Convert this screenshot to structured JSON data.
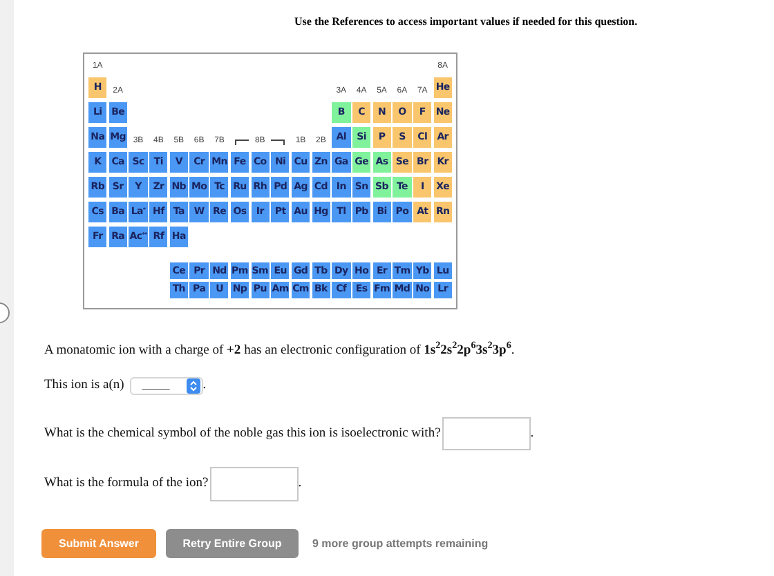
{
  "header": "Use the References to access important values if needed for this question.",
  "periodic_table": {
    "rows": [
      [
        {
          "label": "1A"
        },
        null,
        null,
        null,
        null,
        null,
        null,
        null,
        null,
        null,
        null,
        null,
        null,
        null,
        null,
        null,
        null,
        {
          "label": "8A"
        }
      ],
      [
        {
          "symbol": "H",
          "color": "#f9c66d"
        },
        {
          "label": "2A"
        },
        null,
        null,
        null,
        null,
        null,
        null,
        null,
        null,
        null,
        null,
        {
          "label": "3A"
        },
        {
          "label": "4A"
        },
        {
          "label": "5A"
        },
        {
          "label": "6A"
        },
        {
          "label": "7A"
        },
        {
          "symbol": "He",
          "color": "#f9c66d"
        }
      ],
      [
        {
          "symbol": "Li",
          "color": "#4b98f4"
        },
        {
          "symbol": "Be",
          "color": "#4b98f4"
        },
        null,
        null,
        null,
        null,
        null,
        null,
        null,
        null,
        null,
        null,
        {
          "symbol": "B",
          "color": "#80f29c"
        },
        {
          "symbol": "C",
          "color": "#f9c66d"
        },
        {
          "symbol": "N",
          "color": "#f9c66d"
        },
        {
          "symbol": "O",
          "color": "#f9c66d"
        },
        {
          "symbol": "F",
          "color": "#f9c66d"
        },
        {
          "symbol": "Ne",
          "color": "#f9c66d"
        }
      ],
      [
        {
          "symbol": "Na",
          "color": "#4b98f4"
        },
        {
          "symbol": "Mg",
          "color": "#4b98f4"
        },
        {
          "label": "3B"
        },
        {
          "label": "4B"
        },
        {
          "label": "5B"
        },
        {
          "label": "6B"
        },
        {
          "label": "7B"
        },
        {
          "kind": "bracket_start"
        },
        {
          "label": "8B"
        },
        {
          "kind": "bracket_end"
        },
        {
          "label": "1B"
        },
        {
          "label": "2B"
        },
        {
          "symbol": "Al",
          "color": "#4b98f4"
        },
        {
          "symbol": "Si",
          "color": "#80f29c"
        },
        {
          "symbol": "P",
          "color": "#f9c66d"
        },
        {
          "symbol": "S",
          "color": "#f9c66d"
        },
        {
          "symbol": "Cl",
          "color": "#f9c66d"
        },
        {
          "symbol": "Ar",
          "color": "#f9c66d"
        }
      ],
      [
        {
          "symbol": "K",
          "color": "#4b98f4"
        },
        {
          "symbol": "Ca",
          "color": "#4b98f4"
        },
        {
          "symbol": "Sc",
          "color": "#4b98f4"
        },
        {
          "symbol": "Ti",
          "color": "#4b98f4"
        },
        {
          "symbol": "V",
          "color": "#4b98f4"
        },
        {
          "symbol": "Cr",
          "color": "#4b98f4"
        },
        {
          "symbol": "Mn",
          "color": "#4b98f4"
        },
        {
          "symbol": "Fe",
          "color": "#4b98f4"
        },
        {
          "symbol": "Co",
          "color": "#4b98f4"
        },
        {
          "symbol": "Ni",
          "color": "#4b98f4"
        },
        {
          "symbol": "Cu",
          "color": "#4b98f4"
        },
        {
          "symbol": "Zn",
          "color": "#4b98f4"
        },
        {
          "symbol": "Ga",
          "color": "#4b98f4"
        },
        {
          "symbol": "Ge",
          "color": "#80f29c"
        },
        {
          "symbol": "As",
          "color": "#80f29c"
        },
        {
          "symbol": "Se",
          "color": "#f9c66d"
        },
        {
          "symbol": "Br",
          "color": "#f9c66d"
        },
        {
          "symbol": "Kr",
          "color": "#f9c66d"
        }
      ],
      [
        {
          "symbol": "Rb",
          "color": "#4b98f4"
        },
        {
          "symbol": "Sr",
          "color": "#4b98f4"
        },
        {
          "symbol": "Y",
          "color": "#4b98f4"
        },
        {
          "symbol": "Zr",
          "color": "#4b98f4"
        },
        {
          "symbol": "Nb",
          "color": "#4b98f4"
        },
        {
          "symbol": "Mo",
          "color": "#4b98f4"
        },
        {
          "symbol": "Tc",
          "color": "#4b98f4"
        },
        {
          "symbol": "Ru",
          "color": "#4b98f4"
        },
        {
          "symbol": "Rh",
          "color": "#4b98f4"
        },
        {
          "symbol": "Pd",
          "color": "#4b98f4"
        },
        {
          "symbol": "Ag",
          "color": "#4b98f4"
        },
        {
          "symbol": "Cd",
          "color": "#4b98f4"
        },
        {
          "symbol": "In",
          "color": "#4b98f4"
        },
        {
          "symbol": "Sn",
          "color": "#4b98f4"
        },
        {
          "symbol": "Sb",
          "color": "#80f29c"
        },
        {
          "symbol": "Te",
          "color": "#80f29c"
        },
        {
          "symbol": "I",
          "color": "#f9c66d"
        },
        {
          "symbol": "Xe",
          "color": "#f9c66d"
        }
      ],
      [
        {
          "symbol": "Cs",
          "color": "#4b98f4"
        },
        {
          "symbol": "Ba",
          "color": "#4b98f4"
        },
        {
          "symbol": "La$^{*}$",
          "color": "#4b98f4"
        },
        {
          "symbol": "Hf",
          "color": "#4b98f4"
        },
        {
          "symbol": "Ta",
          "color": "#4b98f4"
        },
        {
          "symbol": "W",
          "color": "#4b98f4"
        },
        {
          "symbol": "Re",
          "color": "#4b98f4"
        },
        {
          "symbol": "Os",
          "color": "#4b98f4"
        },
        {
          "symbol": "Ir",
          "color": "#4b98f4"
        },
        {
          "symbol": "Pt",
          "color": "#4b98f4"
        },
        {
          "symbol": "Au",
          "color": "#4b98f4"
        },
        {
          "symbol": "Hg",
          "color": "#4b98f4"
        },
        {
          "symbol": "Tl",
          "color": "#4b98f4"
        },
        {
          "symbol": "Pb",
          "color": "#4b98f4"
        },
        {
          "symbol": "Bi",
          "color": "#4b98f4"
        },
        {
          "symbol": "Po",
          "color": "#4b98f4"
        },
        {
          "symbol": "At",
          "color": "#f9c66d"
        },
        {
          "symbol": "Rn",
          "color": "#f9c66d"
        }
      ],
      [
        {
          "symbol": "Fr",
          "color": "#4b98f4"
        },
        {
          "symbol": "Ra",
          "color": "#4b98f4"
        },
        {
          "symbol": "Ac$^{**}$",
          "color": "#4b98f4"
        },
        {
          "symbol": "Rf",
          "color": "#4b98f4"
        },
        {
          "symbol": "Ha",
          "color": "#4b98f4"
        }
      ]
    ],
    "f_block_rows": [
      [
        {
          "symbol": "Ce",
          "color": "#4b98f4"
        },
        {
          "symbol": "Pr",
          "color": "#4b98f4"
        },
        {
          "symbol": "Nd",
          "color": "#4b98f4"
        },
        {
          "symbol": "Pm",
          "color": "#4b98f4"
        },
        {
          "symbol": "Sm",
          "color": "#4b98f4"
        },
        {
          "symbol": "Eu",
          "color": "#4b98f4"
        },
        {
          "symbol": "Gd",
          "color": "#4b98f4"
        },
        {
          "symbol": "Tb",
          "color": "#4b98f4"
        },
        {
          "symbol": "Dy",
          "color": "#4b98f4"
        },
        {
          "symbol": "Ho",
          "color": "#4b98f4"
        },
        {
          "symbol": "Er",
          "color": "#4b98f4"
        },
        {
          "symbol": "Tm",
          "color": "#4b98f4"
        },
        {
          "symbol": "Yb",
          "color": "#4b98f4"
        },
        {
          "symbol": "Lu",
          "color": "#4b98f4"
        }
      ],
      [
        {
          "symbol": "Th",
          "color": "#4b98f4"
        },
        {
          "symbol": "Pa",
          "color": "#4b98f4"
        },
        {
          "symbol": "U",
          "color": "#4b98f4"
        },
        {
          "symbol": "Np",
          "color": "#4b98f4"
        },
        {
          "symbol": "Pu",
          "color": "#4b98f4"
        },
        {
          "symbol": "Am",
          "color": "#4b98f4"
        },
        {
          "symbol": "Cm",
          "color": "#4b98f4"
        },
        {
          "symbol": "Bk",
          "color": "#4b98f4"
        },
        {
          "symbol": "Cf",
          "color": "#4b98f4"
        },
        {
          "symbol": "Es",
          "color": "#4b98f4"
        },
        {
          "symbol": "Fm",
          "color": "#4b98f4"
        },
        {
          "symbol": "Md",
          "color": "#4b98f4"
        },
        {
          "symbol": "No",
          "color": "#4b98f4"
        },
        {
          "symbol": "Lr",
          "color": "#4b98f4"
        }
      ]
    ]
  },
  "question": "A monatomic ion with a charge of **+2** has an electronic configuration of **1s$^{2}$2s$^{2}$2p$^{6}$3s$^{2}$3p$^{6}$**.",
  "ion_type": {
    "label": "This ion is a(n)",
    "select_value": "_____",
    "after": "."
  },
  "noble_gas": {
    "label": "What is the chemical symbol of the noble gas this ion is isoelectronic with?",
    "after": "."
  },
  "formula": {
    "label": "What is the formula of the ion?",
    "after": "."
  },
  "buttons": {
    "submit": "Submit Answer",
    "retry": "Retry Entire Group"
  },
  "attempts": "9 more group attempts remaining"
}
